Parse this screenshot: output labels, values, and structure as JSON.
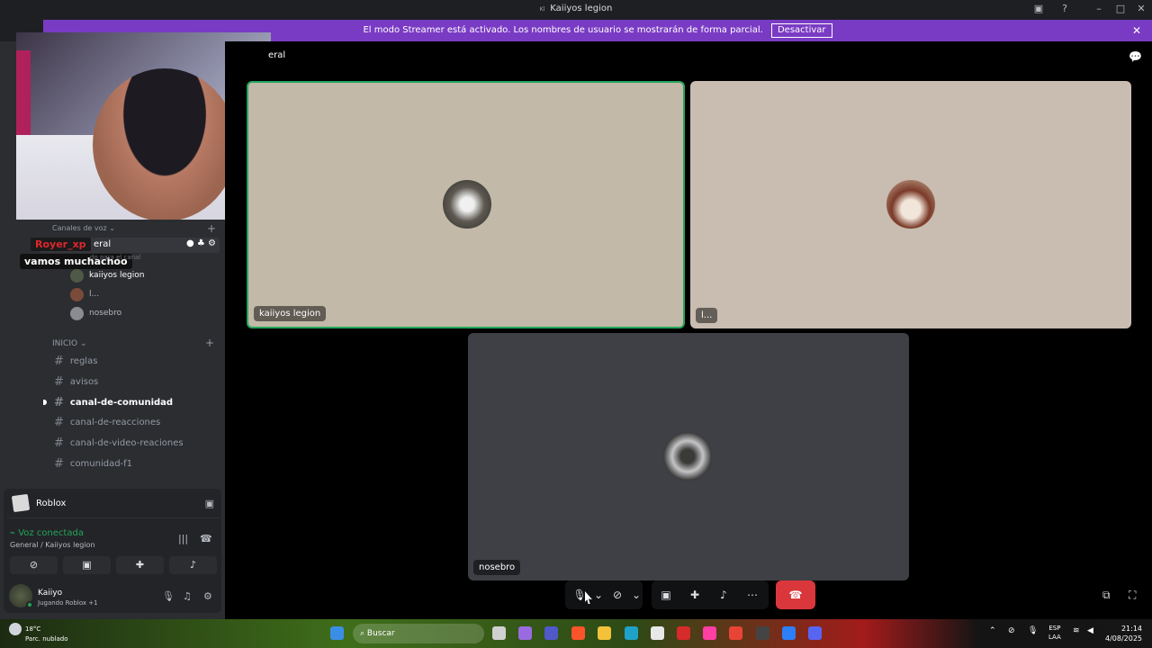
{
  "window": {
    "tag": "Kl",
    "title": "Kaiiyos legion"
  },
  "streamer_bar": {
    "message": "El modo Streamer está activado. Los nombres de usuario se mostrarán de forma parcial.",
    "button": "Desactivar",
    "close": "✕",
    "color": "#7a3bc4"
  },
  "overlay": {
    "name": "Royer_xp",
    "message": "vamos muchachoo"
  },
  "sidebar": {
    "voice_category": "Canales de voz",
    "voice_channel": "eral",
    "voice_hint": "do para el canal",
    "voice_users": [
      "kaiiyos legion",
      "l...",
      "nosebro"
    ],
    "category": "INICIO",
    "channels": [
      "reglas",
      "avisos",
      "canal-de-comunidad",
      "canal-de-reacciones",
      "canal-de-video-reaciones",
      "comunidad-f1"
    ]
  },
  "activity": {
    "name": "Roblox"
  },
  "voice_status": {
    "title": "Voz conectada",
    "subtitle": "General / Kaiiyos legion"
  },
  "user": {
    "name": "Kaiiyo",
    "status": "Jugando Roblox +1"
  },
  "stage": {
    "title": "eral",
    "tiles": [
      {
        "name": "kaiiyos legion",
        "bg": "#c2b9a8"
      },
      {
        "name": "l...",
        "bg": "#c9bcb1"
      },
      {
        "name": "nosebro",
        "bg": "#3e4046"
      }
    ]
  },
  "taskbar": {
    "temp": "18°C",
    "weather": "Parc. nublado",
    "search": "Buscar",
    "lang1": "ESP",
    "lang2": "LAA",
    "time": "21:14",
    "date": "4/08/2025"
  },
  "colors": {
    "hangup": "#da373c",
    "online": "#23a55a",
    "accent": "#7a3bc4"
  }
}
